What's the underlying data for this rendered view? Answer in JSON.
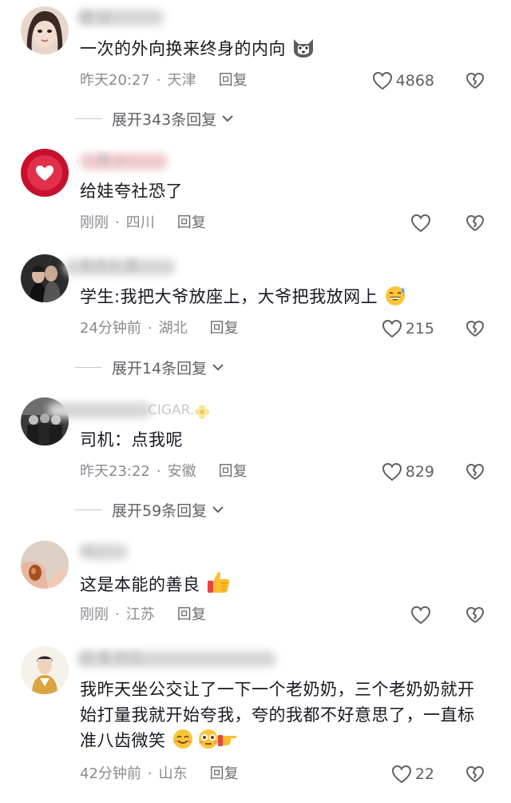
{
  "comments": [
    {
      "username": "麓 拉",
      "text": "一次的外向换来终身的内向",
      "time": "昨天20:27",
      "location": "天津",
      "reply": "回复",
      "likes": "4868",
      "expand": "展开343条回复",
      "emoji": "husky-emoji"
    },
    {
      "username": "♡ 旁 ⊃",
      "text": "给娃夸社恐了",
      "time": "刚刚",
      "location": "四川",
      "reply": "回复",
      "likes": ""
    },
    {
      "username": "有点小 喜",
      "text": "学生:我把大爷放座上，大爷把我放网上",
      "time": "24分钟前",
      "location": "湖北",
      "reply": "回复",
      "likes": "215",
      "expand": "展开14条回复",
      "emoji": "sweat-grin-emoji"
    },
    {
      "username": "CIGAR.",
      "text": "司机：点我呢",
      "time": "昨天23:22",
      "location": "安徽",
      "reply": "回复",
      "likes": "829",
      "expand": "展开59条回复"
    },
    {
      "username": "兴 .",
      "text": "这是本能的善良",
      "time": "刚刚",
      "location": "江苏",
      "reply": "回复",
      "likes": "",
      "emoji": "thumbs-up-emoji"
    },
    {
      "username": "田 看 的见",
      "text": "我昨天坐公交让了一下一个老奶奶，三个老奶奶就开始打量我就开始夸我，夸的我都不好意思了，一直标准八齿微笑",
      "time": "42分钟前",
      "location": "山东",
      "reply": "回复",
      "likes": "22",
      "emoji": "smile-flushed-point-emoji"
    }
  ],
  "colors": {
    "text": "#161823",
    "meta": "#8a8b91",
    "icon": "#5f6066"
  }
}
